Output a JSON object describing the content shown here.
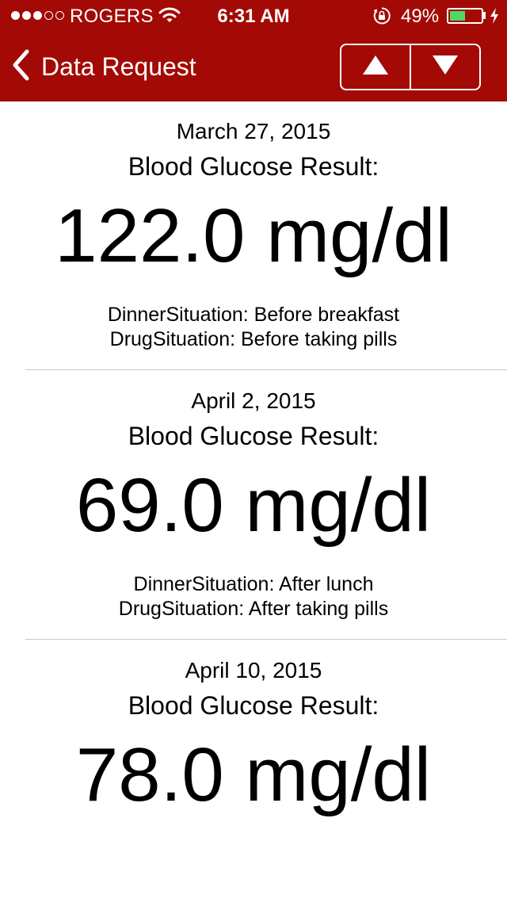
{
  "status_bar": {
    "carrier": "ROGERS",
    "time": "6:31 AM",
    "battery_percent": "49%",
    "battery_level": 0.49,
    "signal_bars_filled": 3,
    "signal_bars_total": 5,
    "icons": [
      "wifi-icon",
      "rotation-lock-icon",
      "battery-icon",
      "charging-bolt-icon"
    ]
  },
  "nav": {
    "title": "Data Request",
    "back_icon": "chevron-left-icon",
    "prev_icon": "triangle-up-icon",
    "next_icon": "triangle-down-icon",
    "bar_color": "#a30a05"
  },
  "records": [
    {
      "date": "March 27, 2015",
      "label": "Blood Glucose Result:",
      "value": "122.0 mg/dl",
      "dinner": "DinnerSituation: Before breakfast",
      "drug": "DrugSituation: Before taking pills"
    },
    {
      "date": "April 2, 2015",
      "label": "Blood Glucose Result:",
      "value": "69.0 mg/dl",
      "dinner": "DinnerSituation: After lunch",
      "drug": "DrugSituation: After taking pills"
    },
    {
      "date": "April 10, 2015",
      "label": "Blood Glucose Result:",
      "value": "78.0 mg/dl"
    }
  ]
}
